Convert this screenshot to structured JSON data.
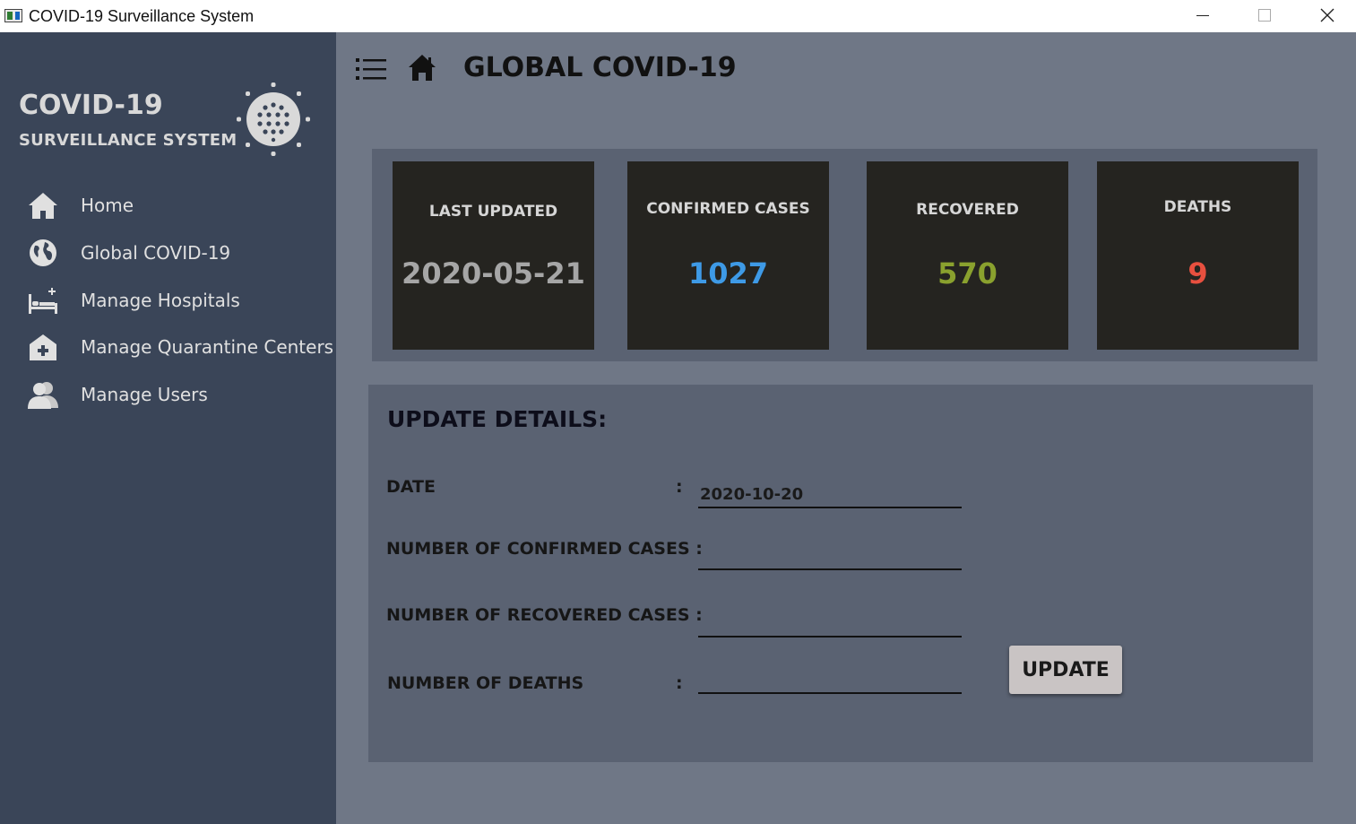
{
  "window": {
    "title": "COVID-19 Surveillance System",
    "controls": [
      "minimize-icon",
      "maximize-icon",
      "close-icon"
    ]
  },
  "sidebar": {
    "brand_title": "COVID-19",
    "brand_subtitle": "SURVEILLANCE SYSTEM",
    "logo_icon": "virus-icon",
    "items": [
      {
        "label": "Home",
        "icon": "home-icon"
      },
      {
        "label": "Global COVID-19",
        "icon": "globe-icon"
      },
      {
        "label": "Manage Hospitals",
        "icon": "hospital-bed-icon"
      },
      {
        "label": "Manage Quarantine Centers",
        "icon": "medical-house-icon"
      },
      {
        "label": "Manage Users",
        "icon": "users-icon"
      }
    ]
  },
  "header": {
    "title": "GLOBAL COVID-19",
    "menu_icon": "list-menu-icon",
    "home_icon": "home-icon"
  },
  "stats": [
    {
      "label": "LAST UPDATED",
      "value": "2020-05-21",
      "color": "#a6a6a6"
    },
    {
      "label": "CONFIRMED CASES",
      "value": "1027",
      "color": "#3e9ae6"
    },
    {
      "label": "RECOVERED",
      "value": "570",
      "color": "#8aa12e"
    },
    {
      "label": "DEATHS",
      "value": "9",
      "color": "#e8503f"
    }
  ],
  "update_form": {
    "title": "UPDATE DETAILS:",
    "fields": [
      {
        "label": "DATE",
        "colon": ":",
        "value": "2020-10-20"
      },
      {
        "label": "NUMBER OF CONFIRMED CASES :",
        "value": ""
      },
      {
        "label": "NUMBER OF RECOVERED CASES :",
        "value": ""
      },
      {
        "label": "NUMBER OF DEATHS",
        "colon": ":",
        "value": ""
      }
    ],
    "button_label": "UPDATE"
  },
  "colors": {
    "sidebar_bg": "#3a4558",
    "main_bg": "#6f7786",
    "panel_bg": "#5a6272",
    "card_bg": "#252420"
  }
}
